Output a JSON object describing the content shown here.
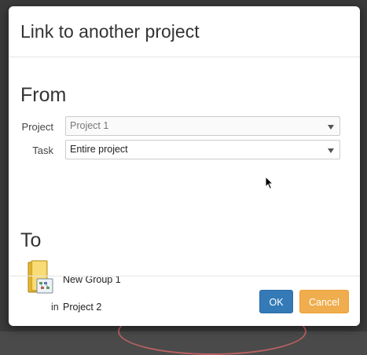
{
  "dialog": {
    "title": "Link to another project",
    "from": {
      "heading": "From",
      "project_label": "Project",
      "project_value": "Project 1",
      "task_label": "Task",
      "task_value": "Entire project"
    },
    "to": {
      "heading": "To",
      "group_name": "New Group 1",
      "in_label": "in",
      "project_name": "Project 2"
    },
    "buttons": {
      "ok": "OK",
      "cancel": "Cancel"
    }
  },
  "colors": {
    "ok_button": "#337ab7",
    "cancel_button": "#f0ad4e"
  },
  "icons": {
    "group": "folder-group-icon",
    "dropdown": "chevron-down-icon",
    "pointer": "mouse-cursor-icon"
  }
}
